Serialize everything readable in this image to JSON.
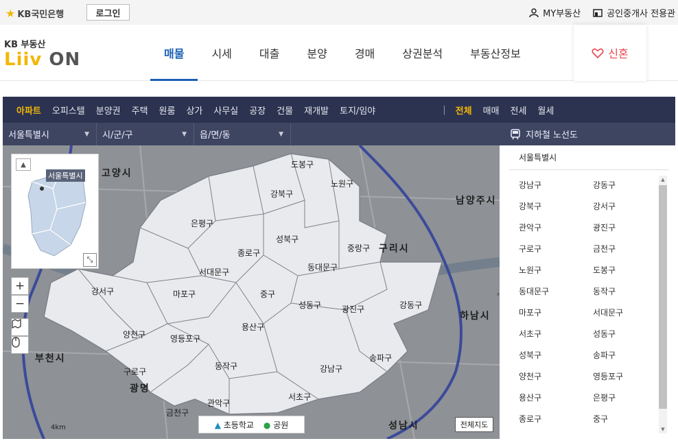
{
  "topbar": {
    "bank_logo": "KB국민은행",
    "login_label": "로그인",
    "my_realestate_label": "MY부동산",
    "agent_label": "공인중개사 전용관"
  },
  "brand": {
    "kb_label": "KB 부동산",
    "liiv_label": "Liiv",
    "on_label": "ON"
  },
  "nav": {
    "tabs": [
      "매물",
      "시세",
      "대출",
      "분양",
      "경매",
      "상권분석",
      "부동산정보"
    ],
    "wedding_label": "신혼"
  },
  "categories": [
    "아파트",
    "오피스텔",
    "분양권",
    "주택",
    "원룸",
    "상가",
    "사무실",
    "공장",
    "건물",
    "재개발",
    "토지/임야"
  ],
  "trade_types": [
    "전체",
    "매매",
    "전세",
    "월세"
  ],
  "filters": {
    "sido": "서울특별시",
    "sigungu": "시/군/구",
    "dong": "읍/면/동",
    "subway_label": "지하철 노선도"
  },
  "map": {
    "minimap_tag": "서울특별시",
    "zoom_in": "+",
    "zoom_out": "−",
    "legend_school": "초등학교",
    "legend_park": "공원",
    "full_map": "전체지도",
    "districts": [
      "도봉구",
      "노원구",
      "강북구",
      "은평구",
      "성북구",
      "종로구",
      "중랑구",
      "서대문구",
      "동대문구",
      "마포구",
      "중구",
      "성동구",
      "광진구",
      "강동구",
      "강서구",
      "용산구",
      "양천구",
      "영등포구",
      "동작구",
      "송파구",
      "구로구",
      "강남구",
      "관악구",
      "서초구",
      "금천구"
    ],
    "cities": [
      "고양시",
      "남양주시",
      "구리시",
      "하남시",
      "부천시",
      "광명",
      "성남시"
    ],
    "scale_label": "4km"
  },
  "panel": {
    "title": "서울특별시",
    "districts": [
      "강남구",
      "강동구",
      "강북구",
      "강서구",
      "관악구",
      "광진구",
      "구로구",
      "금천구",
      "노원구",
      "도봉구",
      "동대문구",
      "동작구",
      "마포구",
      "서대문구",
      "서초구",
      "성동구",
      "성북구",
      "송파구",
      "양천구",
      "영등포구",
      "용산구",
      "은평구",
      "종로구",
      "중구"
    ]
  },
  "colors": {
    "accent": "#1a5fb4",
    "brand_yellow": "#f2b705",
    "navbar_bg": "#2c3350",
    "wedding_red": "#e8434b"
  }
}
